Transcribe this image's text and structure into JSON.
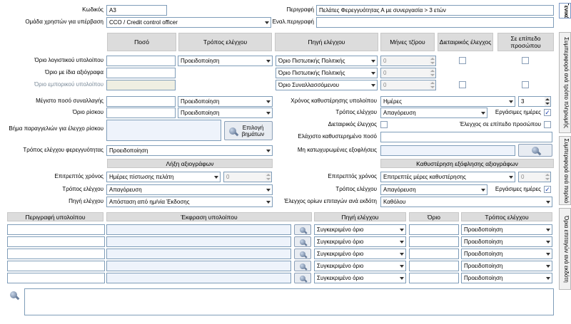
{
  "top": {
    "code_label": "Κωδικός",
    "code_value": "A3",
    "group_label": "Ομάδα χρηστών για υπέρβαση",
    "group_value": "CCO / Credit control officer",
    "desc_label": "Περιγραφή",
    "desc_value": "Πελάτες Φερεγγυότητας Α με συνεργασία > 3 ετών",
    "alt_desc_label": "Εναλ.περιγραφή",
    "alt_desc_value": ""
  },
  "headers": {
    "amount": "Ποσό",
    "check_method": "Τρόπος ελέγχου",
    "check_source": "Πηγή ελέγχου",
    "turnover_months": "Μήνες τζίρου",
    "multi_company": "Διεταιρικός έλεγχος",
    "person_level": "Σε επίπεδο προσώπου"
  },
  "limits": [
    {
      "label": "Όριο λογιστικού υπολοίπου",
      "amount": "",
      "method": "Προειδοποίηση",
      "source": "Όριο Πιστωτικής Πολιτικής",
      "months": "0",
      "multi": false,
      "person": false
    },
    {
      "label": "Όριο με ίδια αξιόγραφα",
      "amount": "",
      "method": "",
      "source": "Όριο Πιστωτικής Πολιτικής",
      "months": "0"
    },
    {
      "label": "Όριο εμπορικού υπολοίπου",
      "amount": "",
      "method": "",
      "source": "Όριο Συναλλασσόμενου",
      "months": "0",
      "multi": false,
      "person": false
    }
  ],
  "max_tx": {
    "label": "Μέγιστο ποσό συναλλαγής",
    "amount": "",
    "method": "Προειδοποίηση"
  },
  "risk": {
    "label": "Όριο ρίσκου",
    "amount": "",
    "method": "Προειδοποίηση"
  },
  "risk_steps": {
    "label": "Βήμα παραγγελιών για έλεγχο ρίσκου",
    "button": "Επιλογή βημάτων"
  },
  "solvency": {
    "label": "Τρόπος ελέγχου φερεγγυότητας",
    "value": "Προειδοποίηση"
  },
  "overdue": {
    "time_label": "Χρόνος καθυστέρησης υπολοίπου",
    "time_value": "Ημέρες",
    "time_num": "3",
    "method_label": "Τρόπος ελέγχου",
    "method_value": "Απαγόρευση",
    "workdays_label": "Εργάσιμες ημέρες",
    "workdays": true,
    "multi_label": "Διεταιρικός έλεγχος",
    "multi": false,
    "person_label": "Έλεγχος σε επίπεδο προσώπου",
    "person": false,
    "min_amount_label": "Ελάχιστο καθυστερημένο ποσό",
    "min_amount": "",
    "uncredited_label": "Μη κατωχυρωμένες εξοφλήσεις",
    "uncredited": ""
  },
  "expiry": {
    "title": "Λήξη αξιογράφων",
    "time_label": "Επιτρεπτός χρόνος",
    "time_value": "Ημέρες πίστωσης πελάτη",
    "time_num": "0",
    "method_label": "Τρόπος ελέγχου",
    "method_value": "Απαγόρευση",
    "source_label": "Πηγή ελέγχου",
    "source_value": "Απόσταση από ημ/νία Έκδοσης"
  },
  "delay": {
    "title": "Καθυστέρηση εξόφλησης αξιογράφων",
    "time_label": "Επιτρεπτός χρόνος",
    "time_value": "Επιτρεπτές μέρες καθυστέρησης",
    "time_num": "0",
    "method_label": "Τρόπος ελέγχου",
    "method_value": "Απαγόρευση",
    "workdays_label": "Εργάσιμες ημέρες",
    "workdays": true,
    "issuer_label": "Έλεγχος ορίων επιταγών ανά εκδότη",
    "issuer_value": "Καθόλου"
  },
  "balances_table": {
    "headers": [
      "Περιγραφή υπολοίπου",
      "Έκφραση υπολοίπου",
      "Πηγή ελέγχου",
      "Όριο",
      "Τρόπος ελέγχου"
    ],
    "rows": [
      [
        "",
        "",
        "Συγκεκριμένο όριο",
        "",
        "Προειδοποίηση"
      ],
      [
        "",
        "",
        "Συγκεκριμένο όριο",
        "",
        "Προειδοποίηση"
      ],
      [
        "",
        "",
        "Συγκεκριμένο όριο",
        "",
        "Προειδοποίηση"
      ],
      [
        "",
        "",
        "Συγκεκριμένο όριο",
        "",
        "Προειδοποίηση"
      ],
      [
        "",
        "",
        "Συγκεκριμένο όριο",
        "",
        "Προειδοποίηση"
      ]
    ]
  },
  "notes": "",
  "tabs": [
    "Γενικά",
    "Συμπεριφορά ανά τρόπο πληρωμής",
    "Συμπεριφορά ανά παρ/κό",
    "Όρια επιταγών ανά εκδότη"
  ],
  "colors": {
    "input_border": "#7f9db9",
    "header_bg": "#dcdcdc",
    "disabled_text": "#7a8a99",
    "blue_field": "#eef3fb"
  }
}
